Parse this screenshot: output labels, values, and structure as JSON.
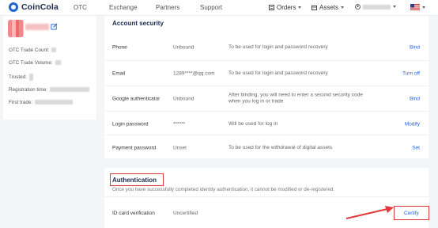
{
  "nav": {
    "brand": "CoinCola",
    "links": [
      "OTC",
      "Exchange",
      "Partners",
      "Support"
    ],
    "orders": "Orders",
    "assets": "Assets"
  },
  "profile": {
    "stats": [
      "OTC Trade Count:",
      "OTC Trade Volume:",
      "Trusted:",
      "Registration time:",
      "First trade:"
    ]
  },
  "security": {
    "title": "Account security",
    "rows": [
      {
        "label": "Phone",
        "value": "Unbound",
        "desc": "To be used for login and password recovery",
        "action": "Bind"
      },
      {
        "label": "Email",
        "value": "1289****@qq.com",
        "desc": "To be used for login and password recovery",
        "action": "Turn off"
      },
      {
        "label": "Google authenticator",
        "value": "Unbound",
        "desc": "After binding, you will need to enter a second security code when you log in or trade",
        "action": "Bind"
      },
      {
        "label": "Login password",
        "value": "******",
        "desc": "Will be used for log in",
        "action": "Modify"
      },
      {
        "label": "Payment password",
        "value": "Unset",
        "desc": "To be used for the withdrawal of digital assets",
        "action": "Set"
      }
    ]
  },
  "auth": {
    "title": "Authentication",
    "subtitle": "Once you have successfully completed identity authentication, it cannot be modified or de-registered.",
    "id_label": "ID card verification",
    "id_value": "Uncertified",
    "certify": "Certify"
  },
  "colors": {
    "accent": "#1e63d6",
    "highlight": "#e23a3a",
    "background": "#f4f5f7"
  },
  "icons": [
    "coincola-logo-icon",
    "orders-icon",
    "assets-icon",
    "user-icon",
    "us-flag-icon",
    "edit-icon"
  ]
}
